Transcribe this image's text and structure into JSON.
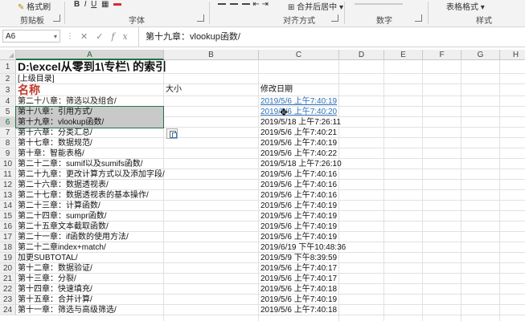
{
  "ribbon": {
    "format_painter": "格式刷",
    "groups": {
      "clipboard": "剪贴板",
      "font": "字体",
      "alignment": "对齐方式",
      "number": "数字",
      "styles": "样式"
    },
    "merge_center": "合并后居中",
    "table_format": "表格格式"
  },
  "formula_bar": {
    "name_box": "A6",
    "formula": "第十九章：vlookup函数/",
    "icons": [
      "cancel-icon",
      "enter-icon",
      "function-icon"
    ]
  },
  "columns": [
    "A",
    "B",
    "C",
    "D",
    "E",
    "F",
    "G",
    "H"
  ],
  "active_column": "A",
  "active_cell": "A6",
  "rows": [
    {
      "n": "1",
      "a": "D:\\excel从零到1\\专栏\\ 的索引",
      "b": "",
      "c": ""
    },
    {
      "n": "2",
      "a": "[上级目录]",
      "b": "",
      "c": ""
    },
    {
      "n": "3",
      "a": "名称",
      "b": "大小",
      "c": "修改日期"
    },
    {
      "n": "4",
      "a": "第二十八章：筛选以及组合/",
      "b": "",
      "c": "2019/5/6 上午7:40:19"
    },
    {
      "n": "5",
      "a": "第十八章：引用方式/",
      "b": "",
      "c": "2019/5/6 上午7:40:20"
    },
    {
      "n": "6",
      "a": "第十九章：vlookup函数/",
      "b": "",
      "c": "2019/5/18 上午7:26:11"
    },
    {
      "n": "7",
      "a": "第十六章：分类汇总/",
      "b": "",
      "c": "2019/5/6 上午7:40:21"
    },
    {
      "n": "8",
      "a": "第十七章：数据规范/",
      "b": "",
      "c": "2019/5/6 上午7:40:19"
    },
    {
      "n": "9",
      "a": "第十章：智能表格/",
      "b": "",
      "c": "2019/5/6 上午7:40:22"
    },
    {
      "n": "10",
      "a": "第二十二章：sumif以及sumifs函数/",
      "b": "",
      "c": "2019/5/18 上午7:26:10"
    },
    {
      "n": "11",
      "a": "第二十九章：更改计算方式以及添加字段/",
      "b": "",
      "c": "2019/5/6 上午7:40:16"
    },
    {
      "n": "12",
      "a": "第二十六章：数据透视表/",
      "b": "",
      "c": "2019/5/6 上午7:40:16"
    },
    {
      "n": "13",
      "a": "第二十七章：数据透视表的基本操作/",
      "b": "",
      "c": "2019/5/6 上午7:40:16"
    },
    {
      "n": "14",
      "a": "第二十三章：计算函数/",
      "b": "",
      "c": "2019/5/6 上午7:40:19"
    },
    {
      "n": "15",
      "a": "第二十四章：sumpr函数/",
      "b": "",
      "c": "2019/5/6 上午7:40:19"
    },
    {
      "n": "16",
      "a": "第二十五章文本截取函数/",
      "b": "",
      "c": "2019/5/6 上午7:40:19"
    },
    {
      "n": "17",
      "a": "第二十一章：if函数的使用方法/",
      "b": "",
      "c": "2019/5/6 上午7:40:19"
    },
    {
      "n": "18",
      "a": "第二十二章index+match/",
      "b": "",
      "c": "2019/6/19 下午10:48:36"
    },
    {
      "n": "19",
      "a": "加更SUBTOTAL/",
      "b": "",
      "c": "2019/5/9 下午8:39:59"
    },
    {
      "n": "20",
      "a": "第十二章：数据验证/",
      "b": "",
      "c": "2019/5/6 上午7:40:17"
    },
    {
      "n": "21",
      "a": "第十三章：分裂/",
      "b": "",
      "c": "2019/5/6 上午7:40:17"
    },
    {
      "n": "22",
      "a": "第十四章：快速填充/",
      "b": "",
      "c": "2019/5/6 上午7:40:18"
    },
    {
      "n": "23",
      "a": "第十五章：合并计算/",
      "b": "",
      "c": "2019/5/6 上午7:40:19"
    },
    {
      "n": "24",
      "a": "第十一章：筛选与高级筛选/",
      "b": "",
      "c": "2019/5/6 上午7:40:18"
    }
  ],
  "colors": {
    "accent": "#217346",
    "link": "#2e6fb5",
    "heading_red": "#c0392b",
    "highlight": "#c9c9c9"
  }
}
